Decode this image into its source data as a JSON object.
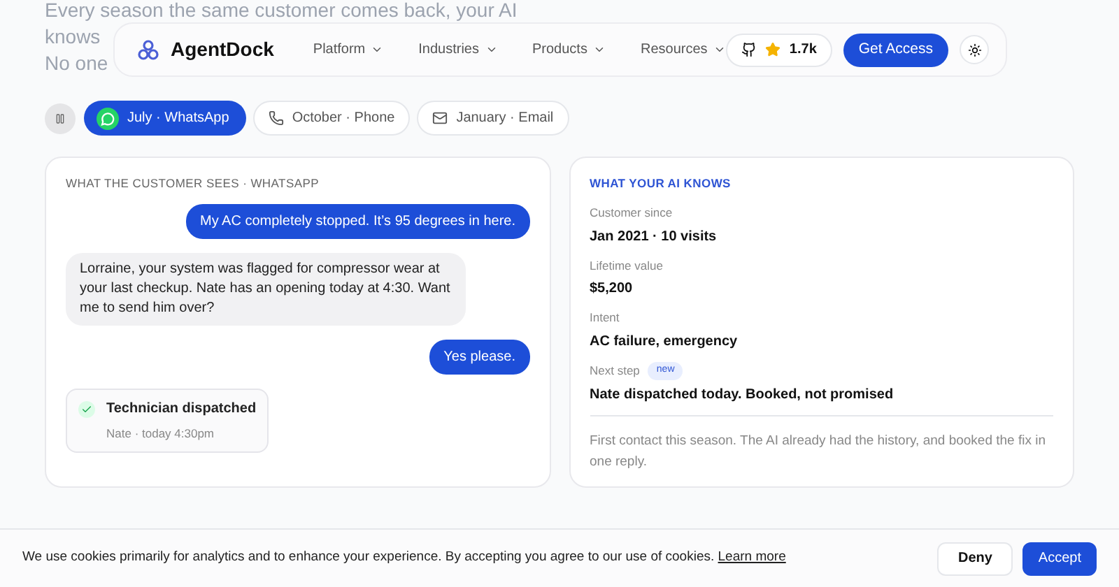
{
  "hero": {
    "lines": [
      "Every season the same customer comes back, your AI",
      "knows",
      "No one"
    ]
  },
  "nav": {
    "brand": "AgentDock",
    "menu": [
      "Platform",
      "Industries",
      "Products",
      "Resources"
    ],
    "stars": "1.7k",
    "cta": "Get Access"
  },
  "tabs": [
    {
      "kind": "whatsapp",
      "label": "July · WhatsApp",
      "selected": true
    },
    {
      "kind": "phone",
      "label": "October · Phone",
      "selected": false
    },
    {
      "kind": "email",
      "label": "January · Email",
      "selected": false
    }
  ],
  "conversation": {
    "title": "WHAT THE CUSTOMER SEES · WHATSAPP",
    "messages": [
      {
        "kind": "sent",
        "text": "My AC completely stopped. It’s 95 degrees in here."
      },
      {
        "kind": "received",
        "text": "Lorraine, your system was flagged for compressor wear at your last checkup. Nate has an opening today at 4:30. Want me to send him over?"
      },
      {
        "kind": "sent",
        "text": "Yes please."
      },
      {
        "kind": "event",
        "text": "Technician dispatched",
        "detail": "Nate · today 4:30pm"
      }
    ]
  },
  "knowledge": {
    "title": "WHAT YOUR AI KNOWS",
    "facts": [
      {
        "label": "Customer since",
        "value": "Jan 2021 · 10 visits"
      },
      {
        "label": "Lifetime value",
        "value": "$5,200"
      },
      {
        "label": "Intent",
        "value": "AC failure, emergency"
      },
      {
        "label": "Next step",
        "badge": "new",
        "value": "Nate dispatched today. Booked, not promised"
      }
    ],
    "note": "First contact this season. The AI already had the history, and booked the fix in one reply."
  },
  "cookie_banner": {
    "text": "We use cookies primarily for analytics and to enhance your experience. By accepting you agree to our use of cookies.",
    "link": "Learn more",
    "buttons": [
      "Deny",
      "Accept"
    ]
  }
}
